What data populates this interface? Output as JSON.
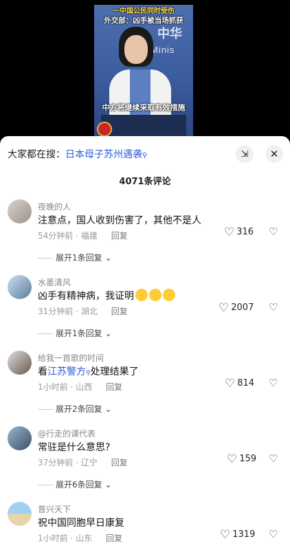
{
  "video": {
    "caption_line1": "一中国公民同时受伤",
    "caption_line2": "外交部：凶手被当场抓获",
    "bg_text": "Minis",
    "bg_zh": "中华",
    "caption_bottom": "中方将继续采取有效措施"
  },
  "search": {
    "prefix": "大家都在搜：",
    "term": "日本母子苏州遇袭",
    "icon": "search-icon"
  },
  "header": {
    "comment_count": "4071条评论",
    "expand_icon": "expand-icon",
    "close_icon": "close-icon"
  },
  "comments": [
    {
      "username": "夜晚的人",
      "text": "注意点，国人收到伤害了，其他不是人",
      "time_loc": "54分钟前 · 福建",
      "reply": "回复",
      "likes": "316",
      "expand": "展开1条回复"
    },
    {
      "username": "水墨清风",
      "text": "凶手有精神病，我证明",
      "time_loc": "31分钟前 · 湖北",
      "reply": "回复",
      "likes": "2007",
      "expand": "展开1条回复"
    },
    {
      "username": "给我一首歌的时间",
      "text_pre": "看",
      "text_hl": "江苏警方",
      "text_post": "处理结果了",
      "time_loc": "1小时前 · 山西",
      "reply": "回复",
      "likes": "814",
      "expand": "展开2条回复"
    },
    {
      "username": "@行走的课代表",
      "text": "常驻是什么意思?",
      "time_loc": "37分钟前 · 辽宁",
      "reply": "回复",
      "likes": "159",
      "expand": "展开6条回复"
    },
    {
      "username": "普兴天下",
      "text": "祝中国同胞早日康复",
      "time_loc": "1小时前 · 山东",
      "reply": "回复",
      "likes": "1319"
    }
  ]
}
